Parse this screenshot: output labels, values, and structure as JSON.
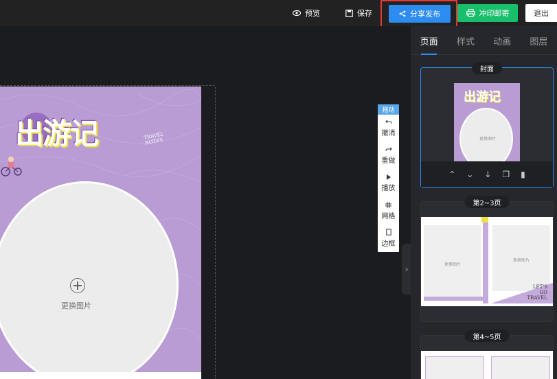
{
  "topbar": {
    "preview_label": "预览",
    "save_label": "保存",
    "share_label": "分享发布",
    "print_label": "冲印邮寄",
    "exit_label": "退出"
  },
  "canvas": {
    "title_art": "出游记",
    "sub_art": "TRAVEL\nNOTES",
    "replace_image_label": "更换图片"
  },
  "tools": {
    "header": "拖动",
    "items": [
      {
        "icon": "undo-icon",
        "label": "撤消"
      },
      {
        "icon": "redo-icon",
        "label": "重做"
      },
      {
        "icon": "play-icon",
        "label": "播放"
      },
      {
        "icon": "grid-icon",
        "label": "网格"
      },
      {
        "icon": "border-icon",
        "label": "边框"
      }
    ]
  },
  "panel": {
    "tabs": [
      "页面",
      "样式",
      "动画",
      "图层"
    ],
    "active_tab": "页面",
    "pages": [
      {
        "label": "封面",
        "thumb_title": "出游记",
        "thumb_text": "更换图片"
      },
      {
        "label": "第2~3页",
        "thumb_left": "更换图片",
        "thumb_right": "更换图片",
        "thumb_caption": "LET'S\nGO\nTRAVEL"
      },
      {
        "label": "第4~5页"
      }
    ]
  },
  "colors": {
    "accent": "#2d8cf0",
    "print": "#19be6b",
    "page_bg": "#b99cd3",
    "highlight_border": "#e53935"
  }
}
